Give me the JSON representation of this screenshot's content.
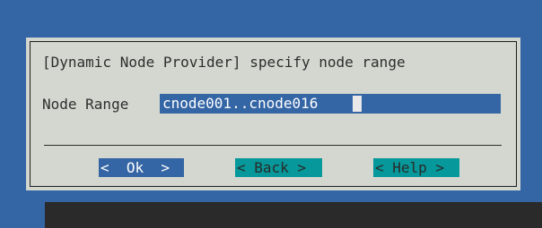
{
  "dialog": {
    "title": "[Dynamic Node Provider] specify node range",
    "field_label": "Node Range",
    "field_value": "cnode001..cnode016"
  },
  "buttons": {
    "ok": "<  Ok  >",
    "back": "< Back >",
    "help": "< Help >"
  },
  "colors": {
    "background": "#3465a4",
    "dialog": "#d3d7cf",
    "selected_button": "#3465a4",
    "button": "#06989a"
  }
}
